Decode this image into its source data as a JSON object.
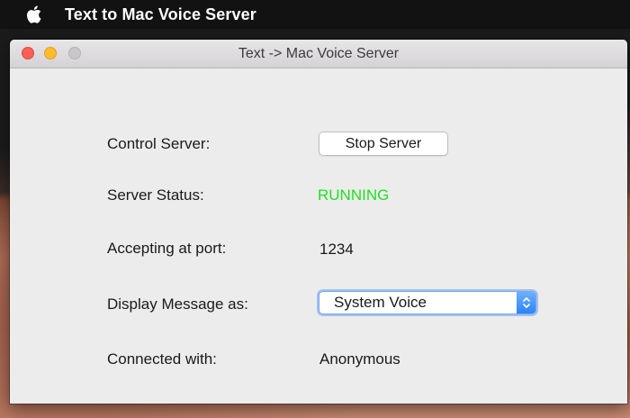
{
  "menubar": {
    "app_title": "Text to Mac Voice Server",
    "apple_icon": "apple-logo-icon"
  },
  "window": {
    "title": "Text -> Mac Voice Server",
    "buttons": {
      "close": "close-icon",
      "minimize": "minimize-icon",
      "zoom": "zoom-icon"
    }
  },
  "control": {
    "label": "Control Server:",
    "button_label": "Stop Server"
  },
  "status": {
    "label": "Server Status:",
    "value": "RUNNING",
    "color": "#1fe021"
  },
  "port": {
    "label": "Accepting at port:",
    "value": "1234"
  },
  "display": {
    "label": "Display Message as:",
    "selected": "System Voice",
    "arrow_icon": "chevron-up-down-icon",
    "accent": "#2c84f5"
  },
  "connected": {
    "label": "Connected with:",
    "value": "Anonymous"
  }
}
